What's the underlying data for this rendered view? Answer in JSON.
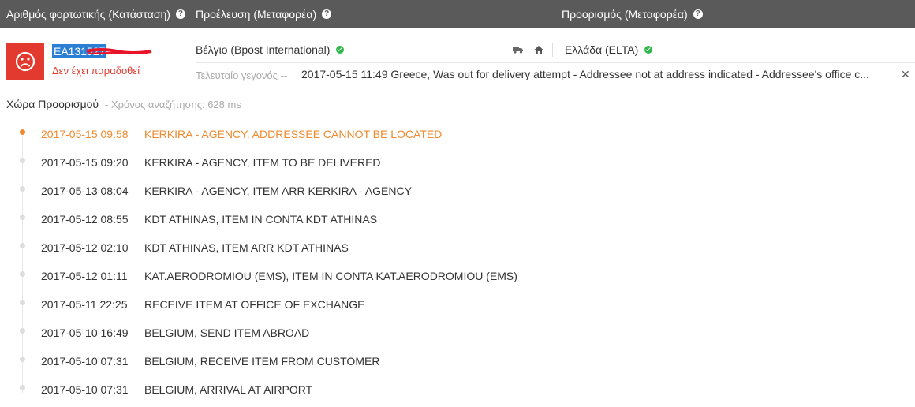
{
  "header": {
    "col1": "Αριθμός φορτωτικής (Κατάσταση)",
    "col2": "Προέλευση (Μεταφορέα)",
    "col3": "Προορισμός (Μεταφορέα)"
  },
  "shipment": {
    "tracking_number": "EA131527",
    "status": "Δεν έχει παραδοθεί",
    "origin": "Βέλγιο (Bpost International)",
    "destination": "Ελλάδα (ELTA)",
    "last_event_label": "Τελευταίο γεγονός --",
    "last_event": "2017-05-15 11:49 Greece, Was out for delivery attempt - Addressee not at address indicated - Addressee's office c..."
  },
  "details": {
    "title": "Χώρα Προορισμού",
    "search_time": "- Χρόνος αναζήτησης: 628 ms"
  },
  "events": [
    {
      "datetime": "2017-05-15 09:58",
      "text": "KERKIRA - AGENCY, ADDRESSEE CANNOT BE LOCATED"
    },
    {
      "datetime": "2017-05-15 09:20",
      "text": "KERKIRA - AGENCY, ITEM TO BE DELIVERED"
    },
    {
      "datetime": "2017-05-13 08:04",
      "text": "KERKIRA - AGENCY, ITEM ARR KERKIRA - AGENCY"
    },
    {
      "datetime": "2017-05-12 08:55",
      "text": "KDT ATHINAS, ITEM IN CONTA KDT ATHINAS"
    },
    {
      "datetime": "2017-05-12 02:10",
      "text": "KDT ATHINAS, ITEM ARR KDT ATHINAS"
    },
    {
      "datetime": "2017-05-12 01:11",
      "text": "KAT.AERODROMIOU (EMS), ITEM IN CONTA KAT.AERODROMIOU (EMS)"
    },
    {
      "datetime": "2017-05-11 22:25",
      "text": "RECEIVE ITEM AT OFFICE OF EXCHANGE"
    },
    {
      "datetime": "2017-05-10 16:49",
      "text": "BELGIUM, SEND ITEM ABROAD"
    },
    {
      "datetime": "2017-05-10 07:31",
      "text": "BELGIUM, RECEIVE ITEM FROM CUSTOMER"
    },
    {
      "datetime": "2017-05-10 07:31",
      "text": "BELGIUM, ARRIVAL AT AIRPORT"
    }
  ],
  "colors": {
    "header_bg": "#5a5a5a",
    "status_red": "#e33a2f",
    "active_orange": "#ef8a2e",
    "ok_green": "#2db84a"
  },
  "icons": [
    "help-icon",
    "sad-face-icon",
    "check-icon",
    "truck-icon",
    "home-icon",
    "close-icon"
  ]
}
